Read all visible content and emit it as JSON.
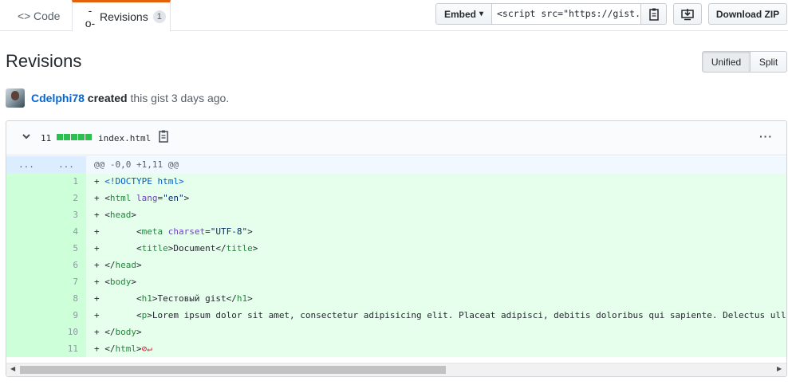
{
  "tabs": {
    "code_icon": "<>",
    "code_label": "Code",
    "revisions_icon": "-o-",
    "revisions_label": "Revisions",
    "revisions_count": "1"
  },
  "toolbar": {
    "embed_label": "Embed",
    "embed_caret": "▾",
    "embed_value": "<script src=\"https://gist.",
    "copy_icon": "clippy-icon",
    "desktop_icon": "desktop-download-icon",
    "download_zip_label": "Download ZIP"
  },
  "page": {
    "title": "Revisions",
    "view_unified": "Unified",
    "view_split": "Split"
  },
  "byline": {
    "user": "Cdelphi78",
    "verb": "created",
    "rest": "this gist 3 days ago."
  },
  "file": {
    "additions": "11",
    "filename": "index.html",
    "hunk_ln1": "...",
    "hunk_ln2": "...",
    "hunk_header": "@@ -0,0 +1,11 @@",
    "lines": [
      {
        "n": "1",
        "prefix": "+ ",
        "indent": "",
        "parts": [
          {
            "t": "<!DOCTYPE html>",
            "c": "d"
          }
        ]
      },
      {
        "n": "2",
        "prefix": "+ ",
        "indent": "",
        "parts": [
          {
            "t": "<",
            "c": ""
          },
          {
            "t": "html",
            "c": "k"
          },
          {
            "t": " ",
            "c": ""
          },
          {
            "t": "lang",
            "c": "a"
          },
          {
            "t": "=",
            "c": ""
          },
          {
            "t": "\"en\"",
            "c": "s"
          },
          {
            "t": ">",
            "c": ""
          }
        ]
      },
      {
        "n": "3",
        "prefix": "+ ",
        "indent": "",
        "parts": [
          {
            "t": "<",
            "c": ""
          },
          {
            "t": "head",
            "c": "k"
          },
          {
            "t": ">",
            "c": ""
          }
        ]
      },
      {
        "n": "4",
        "prefix": "+ ",
        "indent": "      ",
        "parts": [
          {
            "t": "<",
            "c": ""
          },
          {
            "t": "meta",
            "c": "k"
          },
          {
            "t": " ",
            "c": ""
          },
          {
            "t": "charset",
            "c": "a"
          },
          {
            "t": "=",
            "c": ""
          },
          {
            "t": "\"UTF-8\"",
            "c": "s"
          },
          {
            "t": ">",
            "c": ""
          }
        ]
      },
      {
        "n": "5",
        "prefix": "+ ",
        "indent": "      ",
        "parts": [
          {
            "t": "<",
            "c": ""
          },
          {
            "t": "title",
            "c": "k"
          },
          {
            "t": ">Document</",
            "c": ""
          },
          {
            "t": "title",
            "c": "k"
          },
          {
            "t": ">",
            "c": ""
          }
        ]
      },
      {
        "n": "6",
        "prefix": "+ ",
        "indent": "",
        "parts": [
          {
            "t": "</",
            "c": ""
          },
          {
            "t": "head",
            "c": "k"
          },
          {
            "t": ">",
            "c": ""
          }
        ]
      },
      {
        "n": "7",
        "prefix": "+ ",
        "indent": "",
        "parts": [
          {
            "t": "<",
            "c": ""
          },
          {
            "t": "body",
            "c": "k"
          },
          {
            "t": ">",
            "c": ""
          }
        ]
      },
      {
        "n": "8",
        "prefix": "+ ",
        "indent": "      ",
        "parts": [
          {
            "t": "<",
            "c": ""
          },
          {
            "t": "h1",
            "c": "k"
          },
          {
            "t": ">Тестовый gist</",
            "c": ""
          },
          {
            "t": "h1",
            "c": "k"
          },
          {
            "t": ">",
            "c": ""
          }
        ]
      },
      {
        "n": "9",
        "prefix": "+ ",
        "indent": "      ",
        "parts": [
          {
            "t": "<",
            "c": ""
          },
          {
            "t": "p",
            "c": "k"
          },
          {
            "t": ">Lorem ipsum dolor sit amet, consectetur adipisicing elit. Placeat adipisci, debitis doloribus qui sapiente. Delectus ulla",
            "c": ""
          }
        ]
      },
      {
        "n": "10",
        "prefix": "+ ",
        "indent": "",
        "parts": [
          {
            "t": "</",
            "c": ""
          },
          {
            "t": "body",
            "c": "k"
          },
          {
            "t": ">",
            "c": ""
          }
        ]
      },
      {
        "n": "11",
        "prefix": "+ ",
        "indent": "",
        "parts": [
          {
            "t": "</",
            "c": ""
          },
          {
            "t": "html",
            "c": "k"
          },
          {
            "t": ">",
            "c": ""
          }
        ],
        "nonl": "⊘↵"
      }
    ]
  },
  "colors": {
    "accent_tab": "#e36209",
    "link": "#0366d6",
    "addition_bg": "#e6ffed",
    "addition_gutter": "#cdffd8",
    "hunk_bg": "#f1f8ff",
    "diffstat_green": "#2cbe4e"
  }
}
